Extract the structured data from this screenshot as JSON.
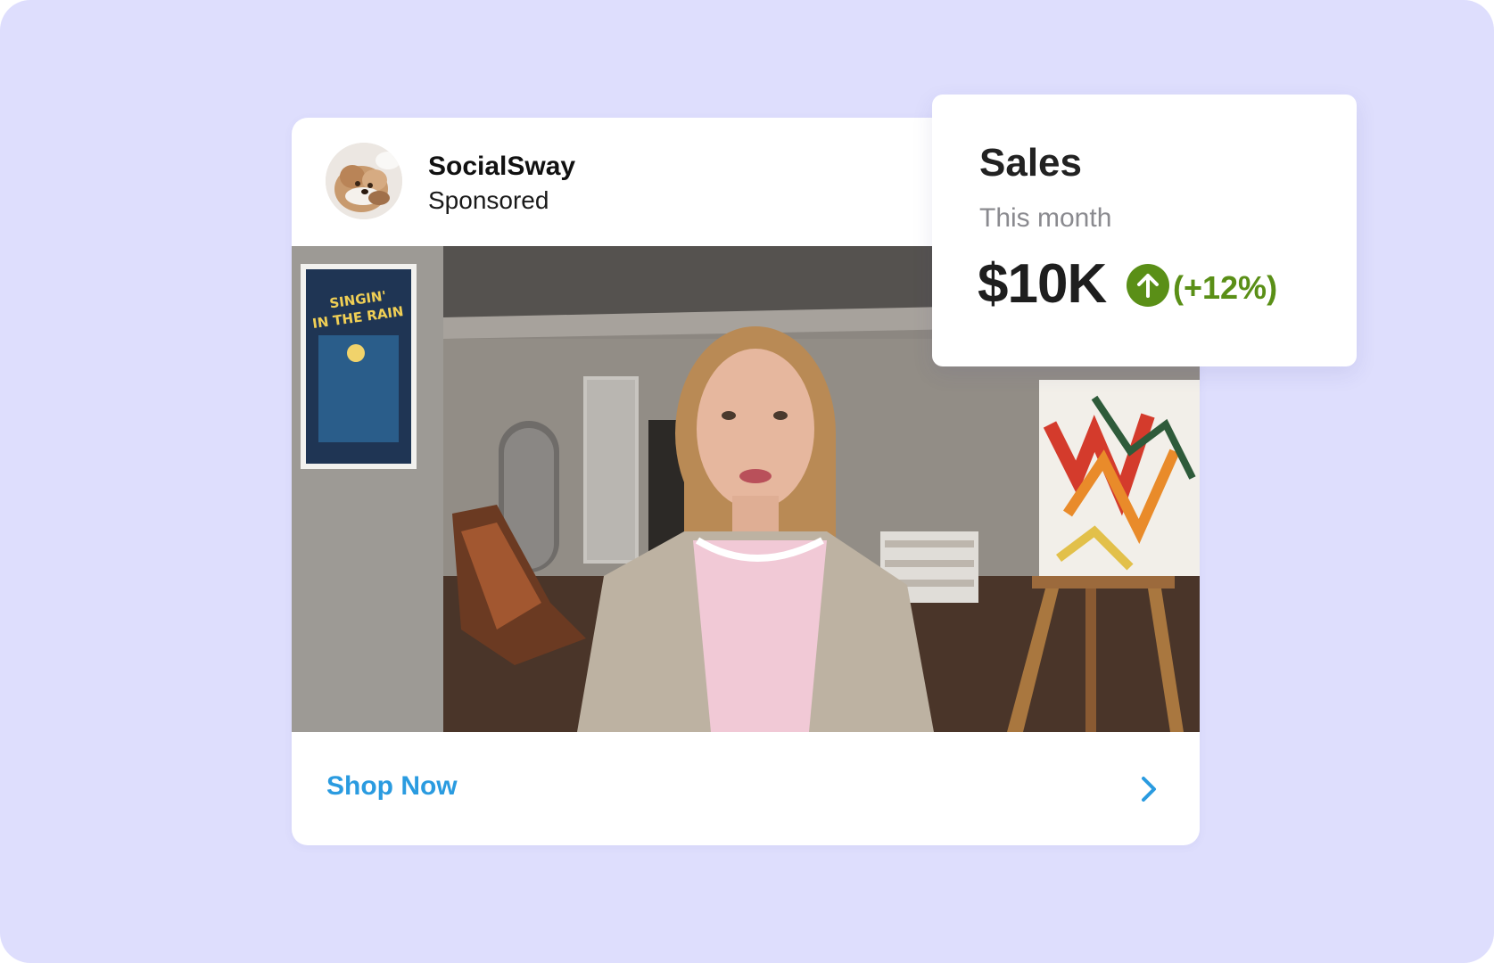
{
  "ad": {
    "brand_name": "SocialSway",
    "sponsored_label": "Sponsored",
    "cta_label": "Shop Now",
    "cta_icon": "chevron-right-icon",
    "avatar_icon": "dog-avatar-image",
    "media": {
      "type": "video-frame",
      "poster_text_line1": "SINGIN'",
      "poster_text_line2": "IN THE RAIN"
    }
  },
  "sales": {
    "title": "Sales",
    "period": "This month",
    "value": "$10K",
    "change": "(+12%)",
    "trend_icon": "arrow-up-circle-icon"
  },
  "colors": {
    "background": "#dedefd",
    "cta": "#2a9be0",
    "trend_positive": "#5a8f17"
  }
}
